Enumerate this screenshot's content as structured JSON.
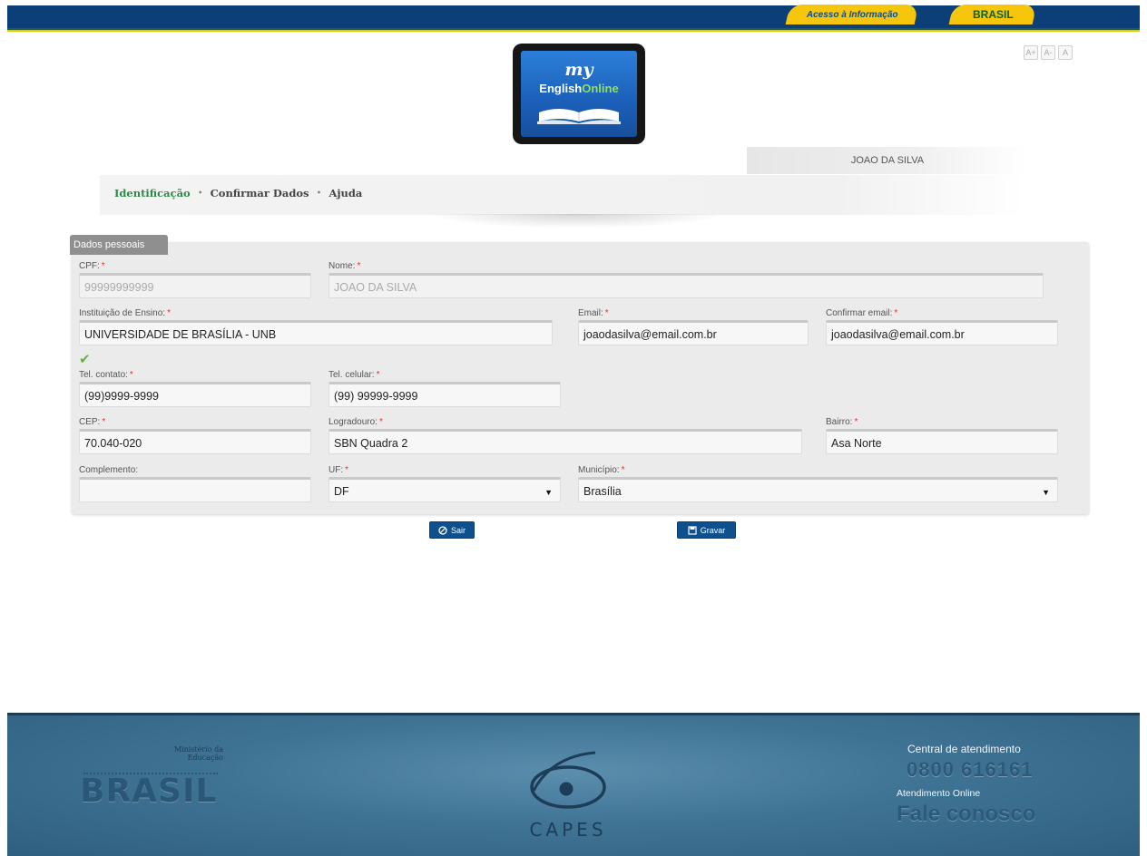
{
  "header": {
    "acesso_label": "Acesso à Informação",
    "brasil_label": "BRASIL",
    "font_controls": [
      "A+",
      "A-",
      "A"
    ]
  },
  "logo": {
    "line1": "my",
    "line2_a": "English",
    "line2_b": "Online"
  },
  "user": {
    "name": "JOAO DA SILVA"
  },
  "nav": {
    "items": [
      "Identificação",
      "Confirmar Dados",
      "Ajuda"
    ],
    "separator": "•"
  },
  "panel": {
    "title": "Dados pessoais"
  },
  "form": {
    "cpf": {
      "label": "CPF:",
      "value": "99999999999"
    },
    "nome": {
      "label": "Nome:",
      "value": "JOAO DA SILVA"
    },
    "instituicao": {
      "label": "Instituição de Ensino:",
      "value": "UNIVERSIDADE DE BRASÍLIA - UNB"
    },
    "email": {
      "label": "Email:",
      "value": "joaodasilva@email.com.br"
    },
    "confirmar_email": {
      "label": "Confirmar email:",
      "value": "joaodasilva@email.com.br"
    },
    "tel_contato": {
      "label": "Tel. contato:",
      "value": "(99)9999-9999"
    },
    "tel_celular": {
      "label": "Tel. celular:",
      "value": "(99) 99999-9999"
    },
    "cep": {
      "label": "CEP:",
      "value": "70.040-020"
    },
    "logradouro": {
      "label": "Logradouro:",
      "value": "SBN Quadra 2"
    },
    "bairro": {
      "label": "Bairro:",
      "value": "Asa Norte"
    },
    "complemento": {
      "label": "Complemento:",
      "value": ""
    },
    "uf": {
      "label": "UF:",
      "value": "DF"
    },
    "municipio": {
      "label": "Município:",
      "value": "Brasília"
    },
    "required_mark": "*",
    "check_mark": "✔"
  },
  "buttons": {
    "sair": "Sair",
    "gravar": "Gravar"
  },
  "footer": {
    "mec_line1": "Ministério da",
    "mec_line2": "Educação",
    "brasil": "BRASIL",
    "capes": "CAPES",
    "central_label": "Central de atendimento",
    "phone": "0800 616161",
    "atendimento_label": "Atendimento Online",
    "fale": "Fale conosco"
  },
  "colors": {
    "gov_blue": "#0c3f78",
    "accent_yellow": "#f6c60c",
    "nav_active": "#2e8b47",
    "button_blue": "#0e4f8e",
    "footer_blue": "#3f7394"
  }
}
